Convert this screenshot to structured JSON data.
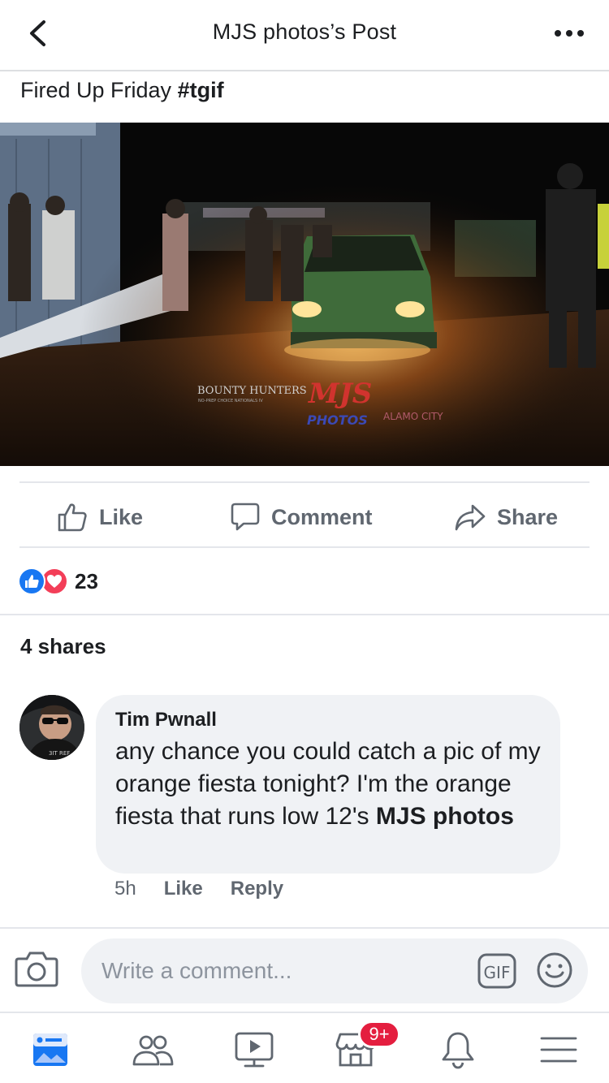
{
  "header": {
    "title": "MJS photos’s Post",
    "back_icon": "chevron-left-icon",
    "more_icon": "more-dots-icon"
  },
  "post": {
    "text": "Fired Up Friday",
    "hashtag": "#tgif",
    "photo_watermarks": {
      "left": "BOUNTY HUNTERS",
      "left_sub": "NO-PREP CHOICE NATIONALS IV",
      "center": "MJS",
      "center_sub": "PHOTOS",
      "right": "ALAMO CITY"
    }
  },
  "actions": {
    "like": "Like",
    "comment": "Comment",
    "share": "Share"
  },
  "reactions": {
    "count": "23"
  },
  "shares": "4 shares",
  "comment": {
    "author": "Tim Pwnall",
    "text": "any chance you could catch a pic of my orange fiesta tonight?  I'm the orange fiesta that runs low 12's",
    "mention": "MJS photos",
    "time": "5h",
    "like": "Like",
    "reply": "Reply"
  },
  "composer": {
    "placeholder": "Write a comment..."
  },
  "tabbar": {
    "items": [
      "news-feed",
      "friends",
      "watch",
      "marketplace",
      "notifications",
      "menu"
    ],
    "marketplace_badge": "9+"
  },
  "colors": {
    "brand_blue": "#1877f2",
    "love_red": "#f33e58",
    "badge_red": "#e41e3f",
    "bubble_bg": "#f0f2f5"
  }
}
